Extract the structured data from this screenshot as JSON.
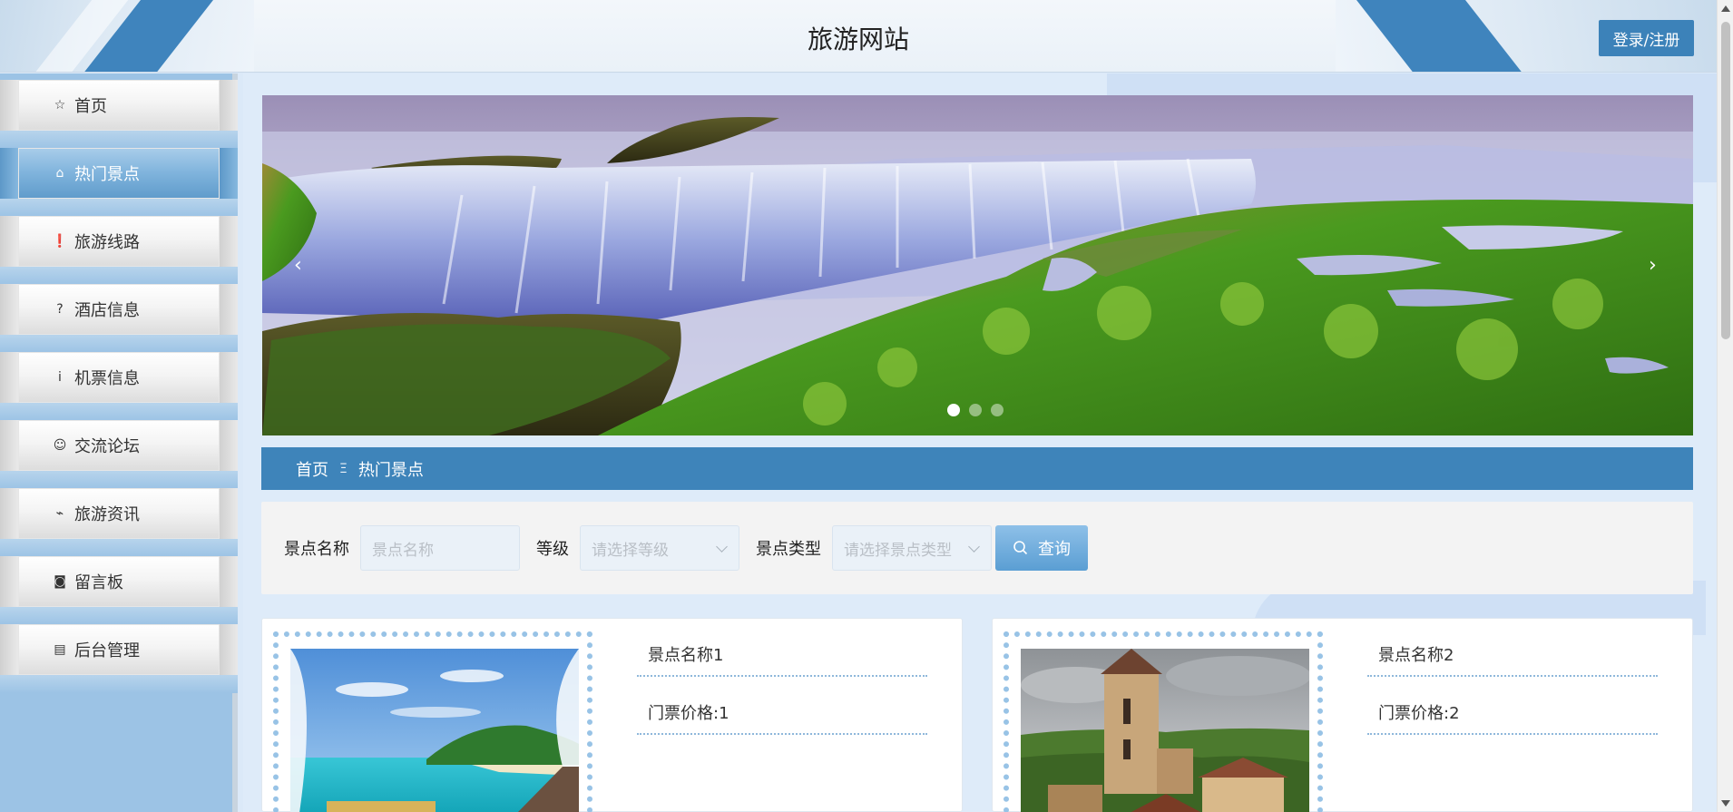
{
  "header": {
    "title": "旅游网站",
    "login_label": "登录/注册"
  },
  "sidebar": {
    "items": [
      {
        "label": "首页",
        "icon": "star-icon",
        "glyph": "☆"
      },
      {
        "label": "热门景点",
        "icon": "bag-icon",
        "glyph": "⌂",
        "active": true
      },
      {
        "label": "旅游线路",
        "icon": "alert-icon",
        "glyph": "❗"
      },
      {
        "label": "酒店信息",
        "icon": "question-icon",
        "glyph": "?"
      },
      {
        "label": "机票信息",
        "icon": "info-icon",
        "glyph": "i"
      },
      {
        "label": "交流论坛",
        "icon": "chat-icon",
        "glyph": "☺"
      },
      {
        "label": "旅游资讯",
        "icon": "trend-icon",
        "glyph": "⌁"
      },
      {
        "label": "留言板",
        "icon": "camera-icon",
        "glyph": "◙"
      },
      {
        "label": "后台管理",
        "icon": "briefcase-icon",
        "glyph": "▤"
      }
    ]
  },
  "carousel": {
    "prev": "‹",
    "next": "›",
    "slide_count": 3,
    "active_index": 0
  },
  "breadcrumb": {
    "home": "首页",
    "separator": "Ξ",
    "current": "热门景点"
  },
  "filter": {
    "name_label": "景点名称",
    "name_placeholder": "景点名称",
    "level_label": "等级",
    "level_placeholder": "请选择等级",
    "type_label": "景点类型",
    "type_placeholder": "请选择景点类型",
    "search_label": "查询"
  },
  "cards": [
    {
      "name": "景点名称1",
      "price": "门票价格:1"
    },
    {
      "name": "景点名称2",
      "price": "门票价格:2"
    }
  ],
  "colors": {
    "primary": "#3e84ba",
    "sidebar": "#9cc3e5",
    "background": "#deebf9"
  }
}
